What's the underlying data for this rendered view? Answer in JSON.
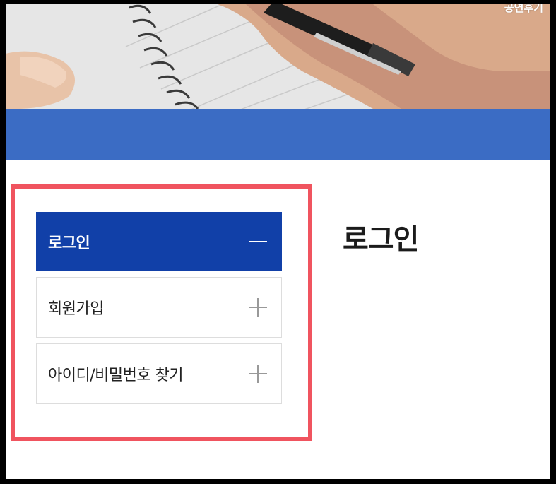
{
  "header": {
    "corner_text": "공연후기"
  },
  "sidebar": {
    "items": [
      {
        "label": "로그인",
        "icon": "minus-icon",
        "active": true
      },
      {
        "label": "회원가입",
        "icon": "plus-icon",
        "active": false
      },
      {
        "label": "아이디/비밀번호 찾기",
        "icon": "plus-icon",
        "active": false
      }
    ]
  },
  "main": {
    "title": "로그인"
  },
  "colors": {
    "accent_band": "#3b6cc4",
    "active_menu": "#1140a8",
    "highlight_outline": "#f0545f"
  }
}
